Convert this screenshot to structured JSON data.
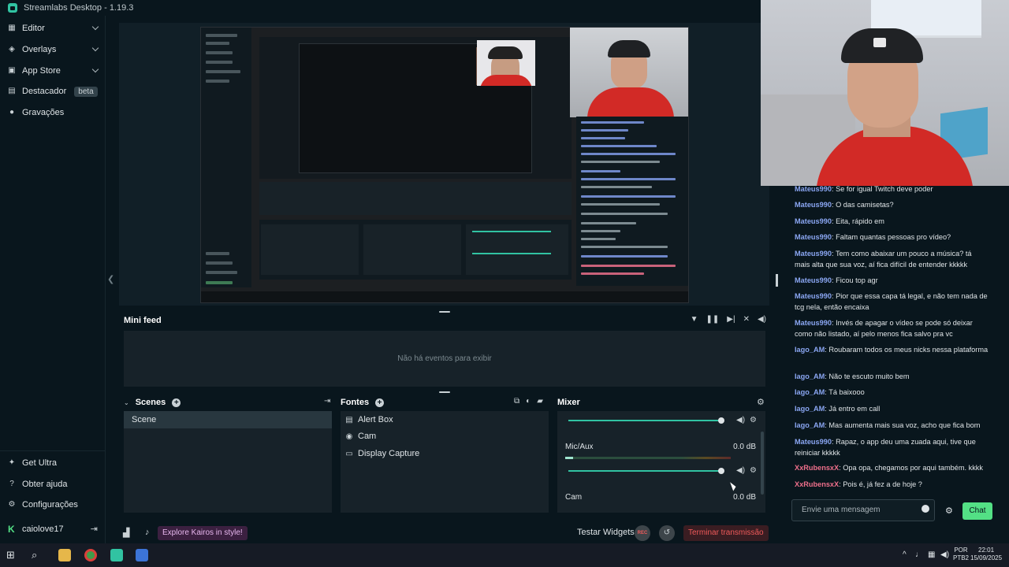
{
  "window": {
    "title": "Streamlabs Desktop - 1.19.3"
  },
  "sidebar": {
    "items": [
      {
        "label": "Editor",
        "icon": "editor-icon"
      },
      {
        "label": "Overlays",
        "icon": "overlays-icon"
      },
      {
        "label": "App Store",
        "icon": "app-store-icon"
      },
      {
        "label": "Destacador",
        "icon": "highlighter-icon",
        "badge": "beta"
      },
      {
        "label": "Gravações",
        "icon": "recordings-icon"
      }
    ],
    "bottom": [
      {
        "label": "Get Ultra",
        "icon": "ultra-icon"
      },
      {
        "label": "Obter ajuda",
        "icon": "help-icon"
      },
      {
        "label": "Configurações",
        "icon": "settings-icon"
      }
    ],
    "user": "caiolove17"
  },
  "minifeed": {
    "title": "Mini feed",
    "empty_text": "Não há eventos para exibir"
  },
  "scenes": {
    "title": "Scenes",
    "items": [
      "Scene"
    ]
  },
  "sources": {
    "title": "Fontes",
    "items": [
      "Alert Box",
      "Cam",
      "Display Capture"
    ]
  },
  "mixer": {
    "title": "Mixer",
    "tracks": [
      {
        "name": "Mic/Aux",
        "db": "0.0 dB"
      },
      {
        "name": "Cam",
        "db": "0.0 dB"
      }
    ]
  },
  "bottombar": {
    "kairos": "Explore Kairos in style!",
    "test_widgets": "Testar Widgets",
    "rec_label": "REC",
    "end_stream": "Terminar transmissão"
  },
  "chat": {
    "messages": [
      {
        "user": "Mateus990",
        "color": "blue",
        "text": "Se for igual Twitch deve poder"
      },
      {
        "user": "Mateus990",
        "color": "blue",
        "text": "O das camisetas?"
      },
      {
        "user": "Mateus990",
        "color": "blue",
        "text": "Eita, rápido em"
      },
      {
        "user": "Mateus990",
        "color": "blue",
        "text": "Faltam quantas pessoas pro vídeo?"
      },
      {
        "user": "Mateus990",
        "color": "blue",
        "text": "Tem como abaixar um pouco a música? tá mais alta que sua voz, aí fica difícil de entender kkkkk"
      },
      {
        "user": "Mateus990",
        "color": "blue",
        "text": "Ficou top agr"
      },
      {
        "user": "Mateus990",
        "color": "blue",
        "text": "Pior que essa capa tá legal, e não tem nada de tcg nela, então encaixa"
      },
      {
        "user": "Mateus990",
        "color": "blue",
        "text": "Invés de apagar o vídeo se pode só deixar como não listado, aí pelo menos fica salvo pra vc"
      },
      {
        "user": "Iago_AM",
        "color": "blue",
        "text": "Roubaram todos os meus nicks nessa plataforma"
      },
      {
        "user": "Iago_AM",
        "color": "blue",
        "text": "Não te escuto muito bem"
      },
      {
        "user": "Iago_AM",
        "color": "blue",
        "text": "Tá baixooo"
      },
      {
        "user": "Iago_AM",
        "color": "blue",
        "text": "Já entro em call"
      },
      {
        "user": "Iago_AM",
        "color": "blue",
        "text": "Mas aumenta mais sua voz, acho que fica bom"
      },
      {
        "user": "Mateus990",
        "color": "blue",
        "text": "Rapaz, o app deu uma zuada aqui, tive que reiniciar kkkkk"
      },
      {
        "user": "XxRubensxX",
        "color": "pink",
        "text": "Opa opa, chegamos por aqui também. kkkk"
      },
      {
        "user": "XxRubensxX",
        "color": "pink",
        "text": "Pois é, já fez a de hoje ?"
      }
    ],
    "input_placeholder": "Envie uma mensagem",
    "send_label": "Chat"
  },
  "taskbar": {
    "lang_line1": "POR",
    "lang_line2": "PTB2",
    "time": "22:01",
    "date": "15/09/2025"
  },
  "colors": {
    "accent": "#31c3a2",
    "chat_button": "#53e085",
    "end_stream": "#f05a5a",
    "user_blue": "#8aa6f2",
    "user_pink": "#ee6f8b"
  }
}
